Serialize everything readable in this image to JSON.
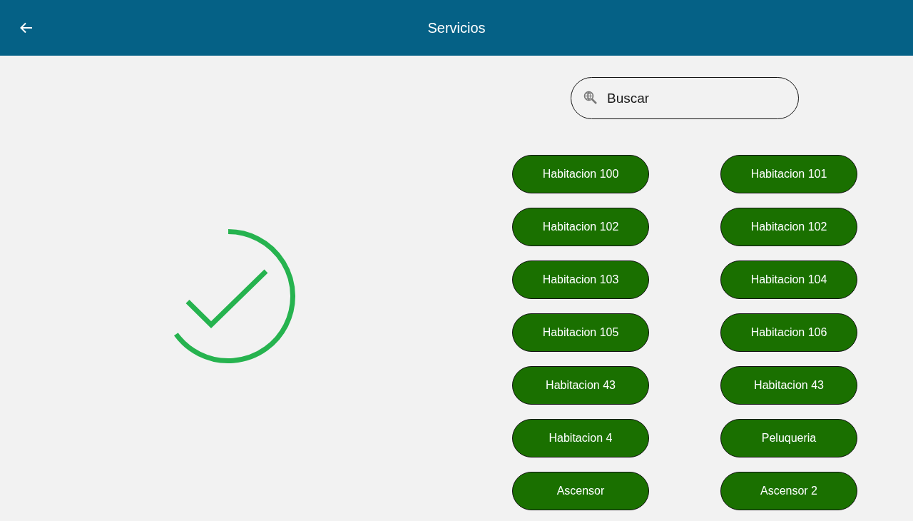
{
  "app_bar": {
    "title": "Servicios"
  },
  "search": {
    "placeholder": "Buscar"
  },
  "services": [
    {
      "label": "Habitacion 100"
    },
    {
      "label": "Habitacion 101"
    },
    {
      "label": "Habitacion 102"
    },
    {
      "label": "Habitacion 102"
    },
    {
      "label": "Habitacion 103"
    },
    {
      "label": "Habitacion 104"
    },
    {
      "label": "Habitacion 105"
    },
    {
      "label": "Habitacion 106"
    },
    {
      "label": "Habitacion 43"
    },
    {
      "label": "Habitacion 43"
    },
    {
      "label": "Habitacion 4"
    },
    {
      "label": "Peluqueria"
    },
    {
      "label": "Ascensor"
    },
    {
      "label": "Ascensor 2"
    }
  ]
}
